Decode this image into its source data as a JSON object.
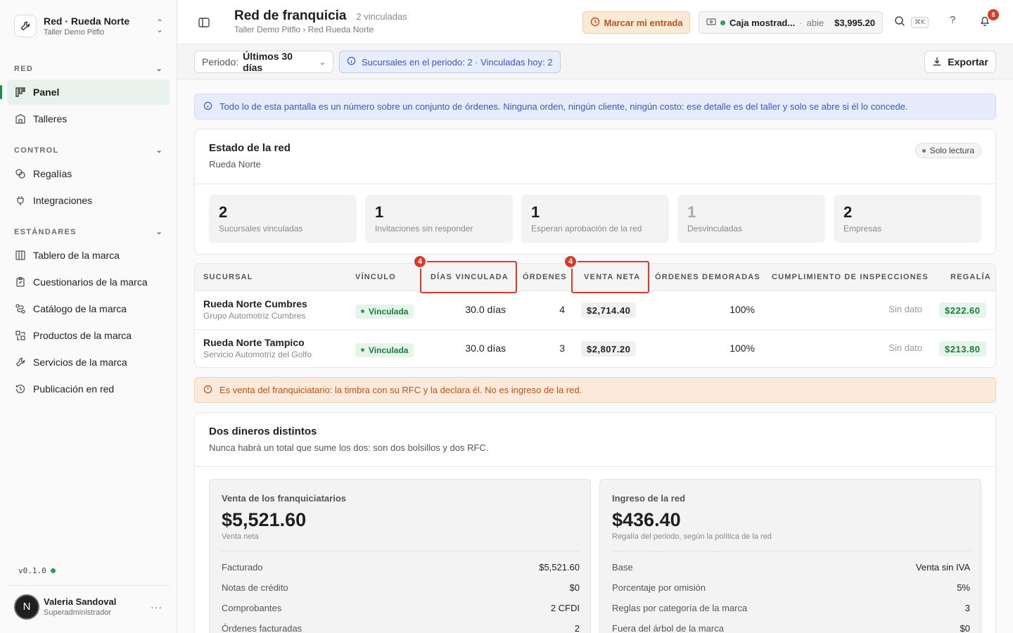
{
  "org": {
    "name": "Red · Rueda Norte",
    "sub": "Taller Demo Pitflo"
  },
  "sidebar": {
    "sections": [
      {
        "label": "RED"
      },
      {
        "label": "CONTROL"
      },
      {
        "label": "ESTÁNDARES"
      }
    ],
    "items": [
      {
        "label": "Panel",
        "icon": "chart-icon"
      },
      {
        "label": "Talleres",
        "icon": "building-icon"
      },
      {
        "label": "Regalías",
        "icon": "coins-icon"
      },
      {
        "label": "Integraciones",
        "icon": "plug-icon"
      },
      {
        "label": "Tablero de la marca",
        "icon": "columns-icon"
      },
      {
        "label": "Cuestionarios de la marca",
        "icon": "clipboard-icon"
      },
      {
        "label": "Catálogo de la marca",
        "icon": "route-icon"
      },
      {
        "label": "Productos de la marca",
        "icon": "boxes-icon"
      },
      {
        "label": "Servicios de la marca",
        "icon": "wrench-icon"
      },
      {
        "label": "Publicación en red",
        "icon": "history-icon"
      }
    ],
    "version": "v0.1.0",
    "user": {
      "initial": "N",
      "name": "Valeria Sandoval",
      "role": "Superadministrador"
    }
  },
  "header": {
    "title": "Red de franquicia",
    "count": "2 vinculadas",
    "breadcrumb": "Taller Demo Pitflo › Red Rueda Norte",
    "clockin": "Marcar mi entrada",
    "cash": {
      "name": "Caja mostrad...",
      "sep": "·",
      "state": "abie",
      "amount": "$3,995.20"
    },
    "kbd": "⌘K",
    "help": "?",
    "notifications": "8"
  },
  "toolbar": {
    "period_label": "Periodo:",
    "period_value": "Últimos 30 días",
    "info": "Sucursales en el periodo: 2 · Vinculadas hoy: 2",
    "export": "Exportar"
  },
  "banner_info": "Todo lo de esta pantalla es un número sobre un conjunto de órdenes. Ninguna orden, ningún cliente, ningún costo: ese detalle es del taller y solo se abre si él lo concede.",
  "estado": {
    "title": "Estado de la red",
    "sub": "Rueda Norte",
    "readonly": "Solo lectura",
    "stats": [
      {
        "num": "2",
        "label": "Sucursales vinculadas"
      },
      {
        "num": "1",
        "label": "Invitaciones sin responder"
      },
      {
        "num": "1",
        "label": "Esperan aprobación de la red"
      },
      {
        "num": "1",
        "label": "Desvinculadas"
      },
      {
        "num": "2",
        "label": "Empresas"
      }
    ]
  },
  "table": {
    "headers": [
      "SUCURSAL",
      "VÍNCULO",
      "DÍAS VINCULADA",
      "ÓRDENES",
      "VENTA NETA",
      "ÓRDENES DEMORADAS",
      "CUMPLIMIENTO DE INSPECCIONES",
      "REGALÍA"
    ],
    "highlight_badge": "4",
    "rows": [
      {
        "name": "Rueda Norte Cumbres",
        "company": "Grupo Automotriz Cumbres",
        "link": "Vinculada",
        "days": "30.0 días",
        "orders": "4",
        "net": "$2,714.40",
        "delayed": "100%",
        "inspections": "Sin dato",
        "royalty": "$222.60"
      },
      {
        "name": "Rueda Norte Tampico",
        "company": "Servicio Automotriz del Golfo",
        "link": "Vinculada",
        "days": "30.0 días",
        "orders": "3",
        "net": "$2,807.20",
        "delayed": "100%",
        "inspections": "Sin dato",
        "royalty": "$213.80"
      }
    ]
  },
  "banner_warning": "Es venta del franquiciatario: la timbra con su RFC y la declara él. No es ingreso de la red.",
  "dos": {
    "title": "Dos dineros distintos",
    "sub": "Nunca habrá un total que sume los dos: son dos bolsillos y dos RFC.",
    "left": {
      "label": "Venta de los franquiciatarios",
      "amount": "$5,521.60",
      "sub": "Venta neta",
      "rows": [
        {
          "k": "Facturado",
          "v": "$5,521.60"
        },
        {
          "k": "Notas de crédito",
          "v": "$0"
        },
        {
          "k": "Comprobantes",
          "v": "2 CFDI"
        },
        {
          "k": "Órdenes facturadas",
          "v": "2"
        }
      ]
    },
    "right": {
      "label": "Ingreso de la red",
      "amount": "$436.40",
      "sub": "Regalía del periodo, según la política de la red",
      "rows": [
        {
          "k": "Base",
          "v": "Venta sin IVA"
        },
        {
          "k": "Porcentaje por omisión",
          "v": "5%"
        },
        {
          "k": "Reglas por categoría de la marca",
          "v": "3"
        },
        {
          "k": "Fuera del árbol de la marca",
          "v": "$0"
        }
      ]
    }
  },
  "colors": {
    "accent_green": "#1f8a4c",
    "highlight_red": "#d93b2b",
    "info_blue": "#3a58c7",
    "warning_orange": "#b4561a"
  }
}
